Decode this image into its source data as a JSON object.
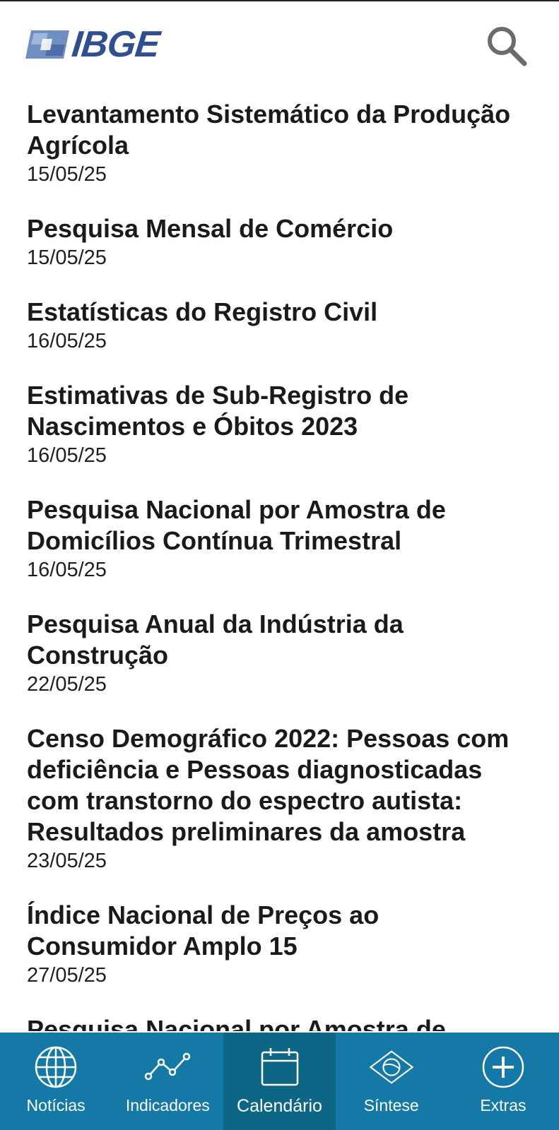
{
  "header": {
    "logo_text": "IBGE",
    "search_icon": "search-icon"
  },
  "releases": [
    {
      "title": "Levantamento Sistemático da Produção Agrícola",
      "date": "15/05/25"
    },
    {
      "title": "Pesquisa Mensal de Comércio",
      "date": "15/05/25"
    },
    {
      "title": "Estatísticas do Registro Civil",
      "date": "16/05/25"
    },
    {
      "title": "Estimativas de Sub-Registro de Nascimentos e Óbitos 2023",
      "date": "16/05/25"
    },
    {
      "title": "Pesquisa Nacional por Amostra de Domicílios Contínua Trimestral",
      "date": "16/05/25"
    },
    {
      "title": "Pesquisa Anual da Indústria da Construção",
      "date": "22/05/25"
    },
    {
      "title": "Censo Demográfico 2022: Pessoas com deficiência e Pessoas diagnosticadas com transtorno do espectro autista: Resultados preliminares da amostra",
      "date": "23/05/25"
    },
    {
      "title": "Índice Nacional de Preços ao Consumidor Amplo 15",
      "date": "27/05/25"
    },
    {
      "title": "Pesquisa Nacional por Amostra de",
      "date": ""
    }
  ],
  "tabs": [
    {
      "label": "Notícias",
      "icon": "globe-icon",
      "active": false
    },
    {
      "label": "Indicadores",
      "icon": "line-chart-icon",
      "active": false
    },
    {
      "label": "Calendário",
      "icon": "calendar-icon",
      "active": true
    },
    {
      "label": "Síntese",
      "icon": "brazil-flag-icon",
      "active": false
    },
    {
      "label": "Extras",
      "icon": "plus-circle-icon",
      "active": false
    }
  ],
  "colors": {
    "tabbar": "#1479a6",
    "tab_active": "#0e6686",
    "logo": "#2f4f8f"
  }
}
